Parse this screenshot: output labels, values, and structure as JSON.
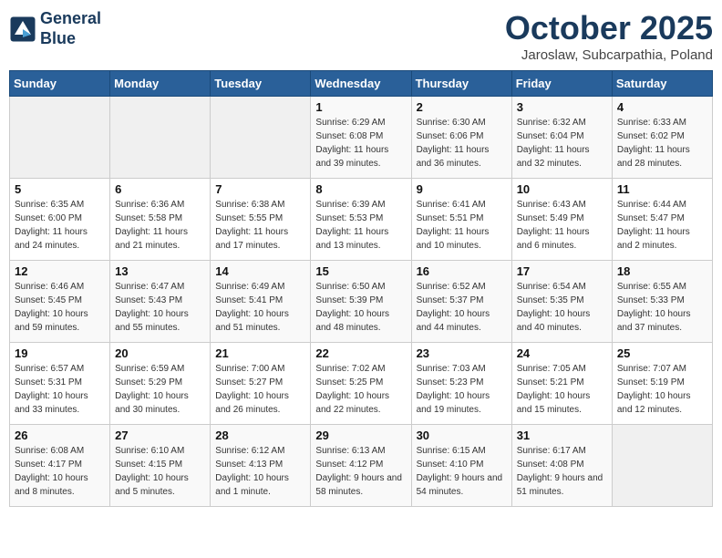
{
  "header": {
    "logo_line1": "General",
    "logo_line2": "Blue",
    "month": "October 2025",
    "location": "Jaroslaw, Subcarpathia, Poland"
  },
  "weekdays": [
    "Sunday",
    "Monday",
    "Tuesday",
    "Wednesday",
    "Thursday",
    "Friday",
    "Saturday"
  ],
  "weeks": [
    [
      {
        "day": "",
        "sunrise": "",
        "sunset": "",
        "daylight": ""
      },
      {
        "day": "",
        "sunrise": "",
        "sunset": "",
        "daylight": ""
      },
      {
        "day": "",
        "sunrise": "",
        "sunset": "",
        "daylight": ""
      },
      {
        "day": "1",
        "sunrise": "Sunrise: 6:29 AM",
        "sunset": "Sunset: 6:08 PM",
        "daylight": "Daylight: 11 hours and 39 minutes."
      },
      {
        "day": "2",
        "sunrise": "Sunrise: 6:30 AM",
        "sunset": "Sunset: 6:06 PM",
        "daylight": "Daylight: 11 hours and 36 minutes."
      },
      {
        "day": "3",
        "sunrise": "Sunrise: 6:32 AM",
        "sunset": "Sunset: 6:04 PM",
        "daylight": "Daylight: 11 hours and 32 minutes."
      },
      {
        "day": "4",
        "sunrise": "Sunrise: 6:33 AM",
        "sunset": "Sunset: 6:02 PM",
        "daylight": "Daylight: 11 hours and 28 minutes."
      }
    ],
    [
      {
        "day": "5",
        "sunrise": "Sunrise: 6:35 AM",
        "sunset": "Sunset: 6:00 PM",
        "daylight": "Daylight: 11 hours and 24 minutes."
      },
      {
        "day": "6",
        "sunrise": "Sunrise: 6:36 AM",
        "sunset": "Sunset: 5:58 PM",
        "daylight": "Daylight: 11 hours and 21 minutes."
      },
      {
        "day": "7",
        "sunrise": "Sunrise: 6:38 AM",
        "sunset": "Sunset: 5:55 PM",
        "daylight": "Daylight: 11 hours and 17 minutes."
      },
      {
        "day": "8",
        "sunrise": "Sunrise: 6:39 AM",
        "sunset": "Sunset: 5:53 PM",
        "daylight": "Daylight: 11 hours and 13 minutes."
      },
      {
        "day": "9",
        "sunrise": "Sunrise: 6:41 AM",
        "sunset": "Sunset: 5:51 PM",
        "daylight": "Daylight: 11 hours and 10 minutes."
      },
      {
        "day": "10",
        "sunrise": "Sunrise: 6:43 AM",
        "sunset": "Sunset: 5:49 PM",
        "daylight": "Daylight: 11 hours and 6 minutes."
      },
      {
        "day": "11",
        "sunrise": "Sunrise: 6:44 AM",
        "sunset": "Sunset: 5:47 PM",
        "daylight": "Daylight: 11 hours and 2 minutes."
      }
    ],
    [
      {
        "day": "12",
        "sunrise": "Sunrise: 6:46 AM",
        "sunset": "Sunset: 5:45 PM",
        "daylight": "Daylight: 10 hours and 59 minutes."
      },
      {
        "day": "13",
        "sunrise": "Sunrise: 6:47 AM",
        "sunset": "Sunset: 5:43 PM",
        "daylight": "Daylight: 10 hours and 55 minutes."
      },
      {
        "day": "14",
        "sunrise": "Sunrise: 6:49 AM",
        "sunset": "Sunset: 5:41 PM",
        "daylight": "Daylight: 10 hours and 51 minutes."
      },
      {
        "day": "15",
        "sunrise": "Sunrise: 6:50 AM",
        "sunset": "Sunset: 5:39 PM",
        "daylight": "Daylight: 10 hours and 48 minutes."
      },
      {
        "day": "16",
        "sunrise": "Sunrise: 6:52 AM",
        "sunset": "Sunset: 5:37 PM",
        "daylight": "Daylight: 10 hours and 44 minutes."
      },
      {
        "day": "17",
        "sunrise": "Sunrise: 6:54 AM",
        "sunset": "Sunset: 5:35 PM",
        "daylight": "Daylight: 10 hours and 40 minutes."
      },
      {
        "day": "18",
        "sunrise": "Sunrise: 6:55 AM",
        "sunset": "Sunset: 5:33 PM",
        "daylight": "Daylight: 10 hours and 37 minutes."
      }
    ],
    [
      {
        "day": "19",
        "sunrise": "Sunrise: 6:57 AM",
        "sunset": "Sunset: 5:31 PM",
        "daylight": "Daylight: 10 hours and 33 minutes."
      },
      {
        "day": "20",
        "sunrise": "Sunrise: 6:59 AM",
        "sunset": "Sunset: 5:29 PM",
        "daylight": "Daylight: 10 hours and 30 minutes."
      },
      {
        "day": "21",
        "sunrise": "Sunrise: 7:00 AM",
        "sunset": "Sunset: 5:27 PM",
        "daylight": "Daylight: 10 hours and 26 minutes."
      },
      {
        "day": "22",
        "sunrise": "Sunrise: 7:02 AM",
        "sunset": "Sunset: 5:25 PM",
        "daylight": "Daylight: 10 hours and 22 minutes."
      },
      {
        "day": "23",
        "sunrise": "Sunrise: 7:03 AM",
        "sunset": "Sunset: 5:23 PM",
        "daylight": "Daylight: 10 hours and 19 minutes."
      },
      {
        "day": "24",
        "sunrise": "Sunrise: 7:05 AM",
        "sunset": "Sunset: 5:21 PM",
        "daylight": "Daylight: 10 hours and 15 minutes."
      },
      {
        "day": "25",
        "sunrise": "Sunrise: 7:07 AM",
        "sunset": "Sunset: 5:19 PM",
        "daylight": "Daylight: 10 hours and 12 minutes."
      }
    ],
    [
      {
        "day": "26",
        "sunrise": "Sunrise: 6:08 AM",
        "sunset": "Sunset: 4:17 PM",
        "daylight": "Daylight: 10 hours and 8 minutes."
      },
      {
        "day": "27",
        "sunrise": "Sunrise: 6:10 AM",
        "sunset": "Sunset: 4:15 PM",
        "daylight": "Daylight: 10 hours and 5 minutes."
      },
      {
        "day": "28",
        "sunrise": "Sunrise: 6:12 AM",
        "sunset": "Sunset: 4:13 PM",
        "daylight": "Daylight: 10 hours and 1 minute."
      },
      {
        "day": "29",
        "sunrise": "Sunrise: 6:13 AM",
        "sunset": "Sunset: 4:12 PM",
        "daylight": "Daylight: 9 hours and 58 minutes."
      },
      {
        "day": "30",
        "sunrise": "Sunrise: 6:15 AM",
        "sunset": "Sunset: 4:10 PM",
        "daylight": "Daylight: 9 hours and 54 minutes."
      },
      {
        "day": "31",
        "sunrise": "Sunrise: 6:17 AM",
        "sunset": "Sunset: 4:08 PM",
        "daylight": "Daylight: 9 hours and 51 minutes."
      },
      {
        "day": "",
        "sunrise": "",
        "sunset": "",
        "daylight": ""
      }
    ]
  ]
}
